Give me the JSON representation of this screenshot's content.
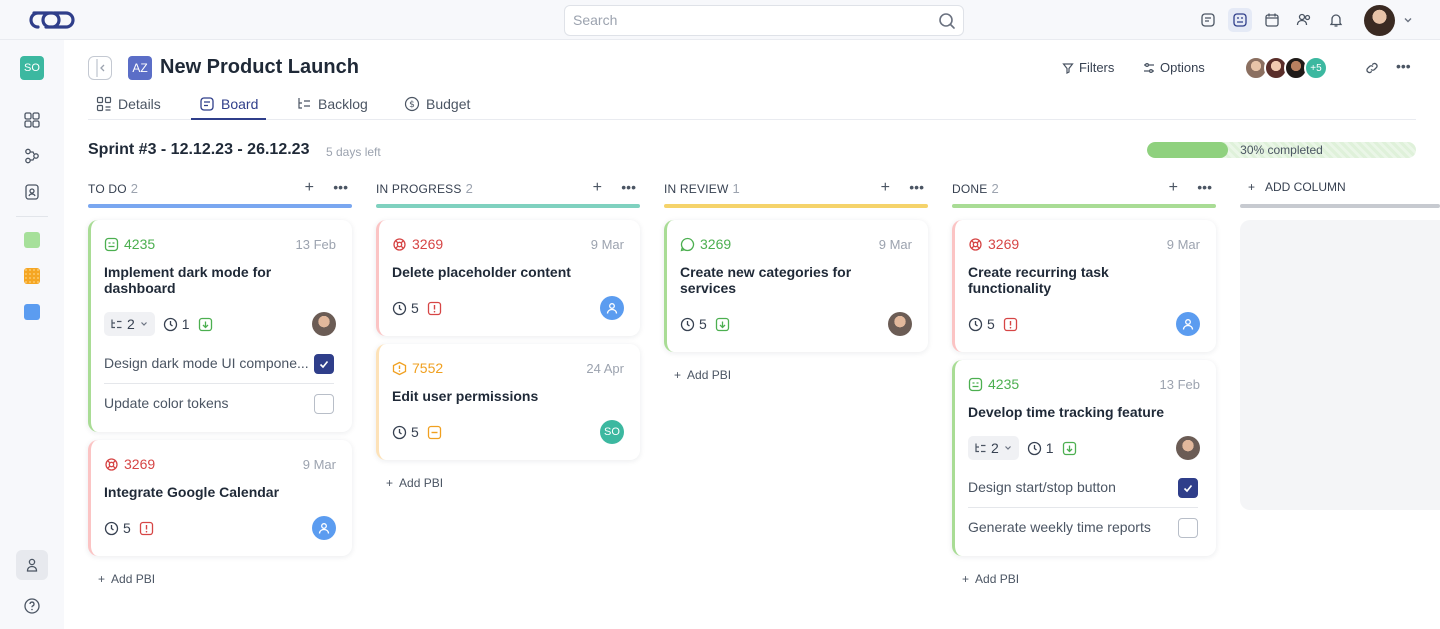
{
  "search": {
    "placeholder": "Search"
  },
  "sidebar": {
    "workspace_initials": "SO"
  },
  "project": {
    "initials": "AZ",
    "title": "New Product Launch"
  },
  "header": {
    "filters_label": "Filters",
    "options_label": "Options",
    "members_more": "+5"
  },
  "tabs": [
    {
      "label": "Details"
    },
    {
      "label": "Board"
    },
    {
      "label": "Backlog"
    },
    {
      "label": "Budget"
    }
  ],
  "sprint": {
    "title": "Sprint #3 - 12.12.23 - 26.12.23",
    "days_left": "5 days left",
    "progress_label": "30% completed",
    "progress": 0.3
  },
  "colors": {
    "accent": "#2f3e8a",
    "todo": "#7aa7f0",
    "in_progress": "#7fd1bf",
    "in_review": "#f5d36b",
    "done": "#a9dc95"
  },
  "columns": [
    {
      "title": "TO DO",
      "count": "2",
      "add_label": "Add PBI",
      "cards": [
        {
          "id": "4235",
          "date": "13 Feb",
          "title": "Implement dark mode for dashboard",
          "subtasks": "2",
          "estimate": "1",
          "checklist": [
            {
              "label": "Design dark mode UI compone...",
              "checked": true
            },
            {
              "label": "Update color tokens",
              "checked": false
            }
          ]
        },
        {
          "id": "3269",
          "date": "9 Mar",
          "title": "Integrate Google Calendar",
          "estimate": "5"
        }
      ]
    },
    {
      "title": "IN PROGRESS",
      "count": "2",
      "add_label": "Add PBI",
      "cards": [
        {
          "id": "3269",
          "date": "9 Mar",
          "title": "Delete placeholder content",
          "estimate": "5"
        },
        {
          "id": "7552",
          "date": "24 Apr",
          "title": "Edit user permissions",
          "estimate": "5",
          "assignee": "SO"
        }
      ]
    },
    {
      "title": "IN REVIEW",
      "count": "1",
      "add_label": "Add PBI",
      "cards": [
        {
          "id": "3269",
          "date": "9 Mar",
          "title": "Create new categories for services",
          "estimate": "5"
        }
      ]
    },
    {
      "title": "DONE",
      "count": "2",
      "add_label": "Add PBI",
      "cards": [
        {
          "id": "3269",
          "date": "9 Mar",
          "title": "Create recurring task functionality",
          "estimate": "5"
        },
        {
          "id": "4235",
          "date": "13 Feb",
          "title": "Develop time tracking feature",
          "subtasks": "2",
          "estimate": "1",
          "checklist": [
            {
              "label": "Design start/stop button",
              "checked": true
            },
            {
              "label": "Generate weekly time reports",
              "checked": false
            }
          ]
        }
      ]
    }
  ],
  "add_column_label": "ADD COLUMN"
}
